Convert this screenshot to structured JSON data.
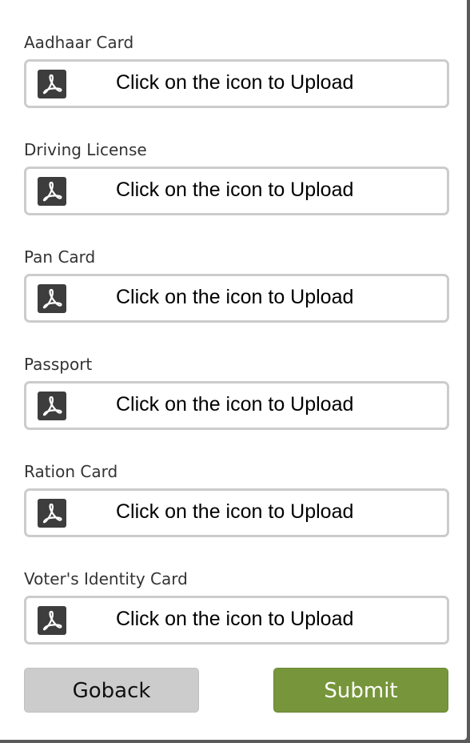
{
  "form": {
    "upload_hint": "Click on the icon to Upload",
    "fields": [
      {
        "label": "Aadhaar Card",
        "icon": "pdf-icon"
      },
      {
        "label": "Driving License",
        "icon": "pdf-icon"
      },
      {
        "label": "Pan Card",
        "icon": "pdf-icon"
      },
      {
        "label": "Passport",
        "icon": "pdf-icon"
      },
      {
        "label": "Ration Card",
        "icon": "pdf-icon"
      },
      {
        "label": "Voter's Identity Card",
        "icon": "pdf-icon"
      }
    ]
  },
  "buttons": {
    "goback_label": "Goback",
    "submit_label": "Submit"
  },
  "colors": {
    "submit_bg": "#77963b",
    "goback_bg": "#cccccc",
    "box_border": "#cccccc",
    "icon_bg": "#3d3d3d"
  }
}
